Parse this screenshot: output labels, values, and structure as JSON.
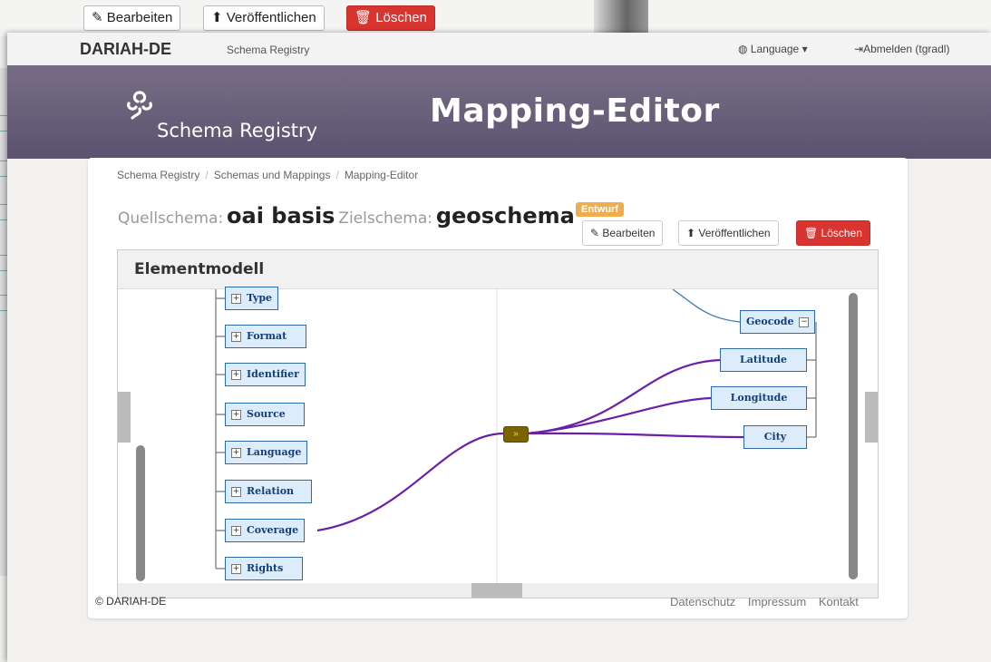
{
  "background_window": {
    "buttons": {
      "edit": "Bearbeiten",
      "publish": "Veröffentlichen",
      "delete": "Löschen"
    }
  },
  "navbar": {
    "brand": "DARIAH-DE",
    "subtitle": "Schema Registry",
    "language": "Language",
    "logout": "Abmelden (tgradl)"
  },
  "header": {
    "logo_text": "Schema Registry",
    "title": "Mapping-Editor"
  },
  "breadcrumb": [
    "Schema Registry",
    "Schemas und Mappings",
    "Mapping-Editor"
  ],
  "mapping": {
    "source_label": "Quellschema:",
    "source_value": "oai basis",
    "target_label": "Zielschema:",
    "target_value": "geoschema",
    "status_badge": "Entwurf"
  },
  "actions": {
    "edit": "Bearbeiten",
    "publish": "Veröffentlichen",
    "delete": "Löschen"
  },
  "editor": {
    "title": "Elementmodell",
    "source_elements": [
      "Type",
      "Format",
      "Identifier",
      "Source",
      "Language",
      "Relation",
      "Coverage",
      "Rights"
    ],
    "target_parent": "Geocode",
    "target_elements": [
      "Latitude",
      "Longitude",
      "City"
    ],
    "mapper_icon": "fast-forward-icon",
    "mapping_color": "#6a1fa8"
  },
  "footer": {
    "copyright": "© DARIAH-DE",
    "links": [
      "Datenschutz",
      "Impressum",
      "Kontakt"
    ]
  },
  "colors": {
    "danger": "#d9342f",
    "badge": "#f0ad4e",
    "header": "#645b77"
  }
}
